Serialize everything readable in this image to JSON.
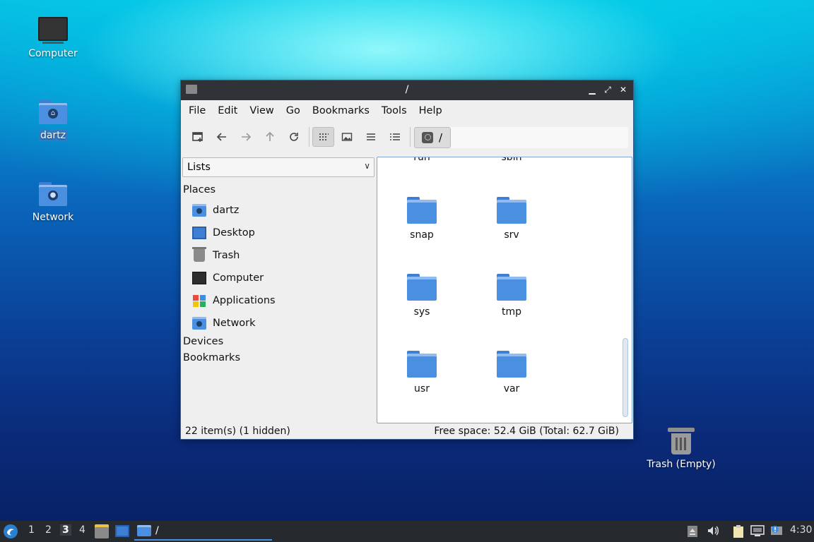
{
  "desktop": {
    "icons": {
      "computer": "Computer",
      "home": "dartz",
      "network": "Network",
      "trash": "Trash (Empty)"
    }
  },
  "window": {
    "title": "/",
    "menu": [
      "File",
      "Edit",
      "Go",
      "View",
      "Bookmarks",
      "Tools",
      "Help"
    ],
    "menu_order": [
      "File",
      "Edit",
      "View",
      "Go",
      "Bookmarks",
      "Tools",
      "Help"
    ],
    "path": "/",
    "sidebar": {
      "mode": "Lists",
      "places_label": "Places",
      "places": [
        "dartz",
        "Desktop",
        "Trash",
        "Computer",
        "Applications",
        "Network"
      ],
      "devices_label": "Devices",
      "bookmarks_label": "Bookmarks"
    },
    "files": {
      "partial": [
        "run",
        "sbin"
      ],
      "row1": [
        "snap",
        "srv"
      ],
      "row2": [
        "sys",
        "tmp"
      ],
      "row3": [
        "usr",
        "var"
      ]
    },
    "status": {
      "items": "22 item(s) (1 hidden)",
      "space": "Free space: 52.4 GiB (Total: 62.7 GiB)"
    }
  },
  "taskbar": {
    "workspaces": [
      "1",
      "2",
      "3",
      "4"
    ],
    "current_workspace": "3",
    "task_title": "/",
    "clock": "4:30"
  },
  "icons": {
    "menu": "lxqt-start-icon",
    "new_window": "new-window-icon",
    "back": "arrow-left-icon",
    "forward": "arrow-right-icon",
    "up": "arrow-up-icon",
    "reload": "reload-icon"
  }
}
